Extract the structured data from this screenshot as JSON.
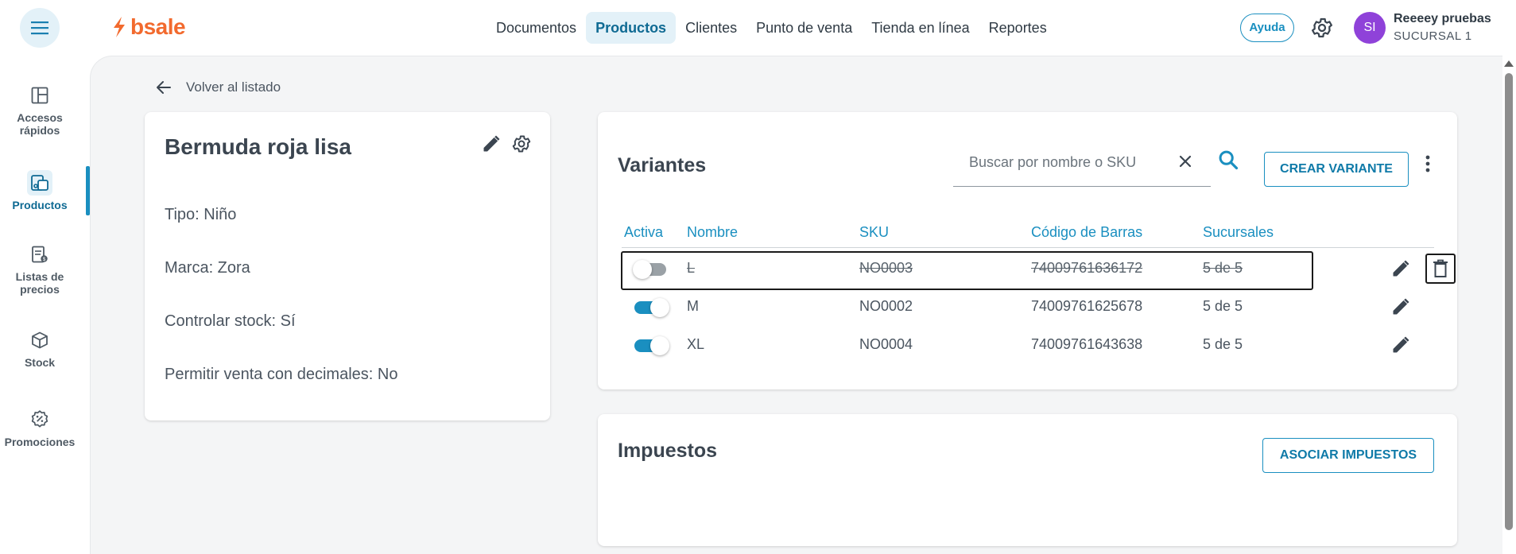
{
  "app": {
    "logo_text": "bsale",
    "brand_color": "#f26a2e",
    "accent_color": "#1a8fc0"
  },
  "header": {
    "nav": [
      {
        "label": "Documentos",
        "active": false
      },
      {
        "label": "Productos",
        "active": true
      },
      {
        "label": "Clientes",
        "active": false
      },
      {
        "label": "Punto de venta",
        "active": false
      },
      {
        "label": "Tienda en línea",
        "active": false
      },
      {
        "label": "Reportes",
        "active": false
      }
    ],
    "help_label": "Ayuda",
    "user": {
      "initials": "SI",
      "name": "Reeeey pruebas",
      "branch": "SUCURSAL 1",
      "avatar_color": "#8f42d9"
    }
  },
  "sidebar": {
    "items": [
      {
        "label": "Accesos rápidos",
        "icon": "dashboard-icon",
        "active": false
      },
      {
        "label": "Productos",
        "icon": "products-icon",
        "active": true
      },
      {
        "label": "Listas de precios",
        "icon": "price-list-icon",
        "active": false
      },
      {
        "label": "Stock",
        "icon": "box-icon",
        "active": false
      },
      {
        "label": "Promociones",
        "icon": "discount-icon",
        "active": false
      }
    ]
  },
  "main": {
    "back_label": "Volver al listado",
    "product": {
      "title": "Bermuda roja lisa",
      "properties": [
        "Tipo: Niño",
        "Marca: Zora",
        "Controlar stock: Sí",
        "Permitir venta con decimales: No"
      ]
    },
    "variants": {
      "title": "Variantes",
      "search_placeholder": "Buscar por nombre o SKU",
      "search_value": "",
      "create_label": "CREAR VARIANTE",
      "columns": [
        "Activa",
        "Nombre",
        "SKU",
        "Código de Barras",
        "Sucursales"
      ],
      "rows": [
        {
          "active": false,
          "name": "L",
          "sku": "NO0003",
          "barcode": "74009761636172",
          "branches": "5 de 5"
        },
        {
          "active": true,
          "name": "M",
          "sku": "NO0002",
          "barcode": "74009761625678",
          "branches": "5 de 5"
        },
        {
          "active": true,
          "name": "XL",
          "sku": "NO0004",
          "barcode": "74009761643638",
          "branches": "5 de 5"
        }
      ]
    },
    "taxes": {
      "title": "Impuestos",
      "button_label": "ASOCIAR IMPUESTOS"
    }
  }
}
